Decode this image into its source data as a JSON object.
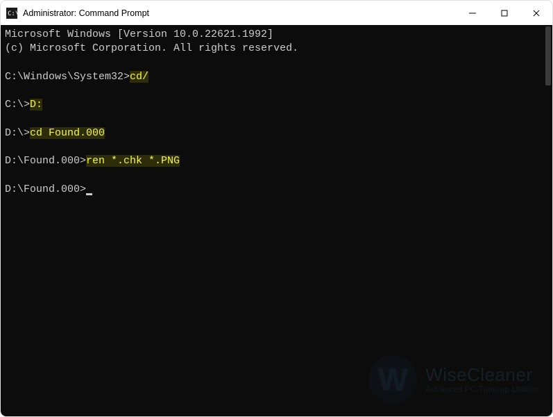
{
  "window": {
    "title": "Administrator: Command Prompt"
  },
  "terminal": {
    "version_line": "Microsoft Windows [Version 10.0.22621.1992]",
    "copyright_line": "(c) Microsoft Corporation. All rights reserved.",
    "entries": [
      {
        "prompt": "C:\\Windows\\System32>",
        "command": "cd/"
      },
      {
        "prompt": "C:\\>",
        "command": "D:"
      },
      {
        "prompt": "D:\\>",
        "command": "cd Found.000"
      },
      {
        "prompt": "D:\\Found.000>",
        "command": "ren *.chk *.PNG"
      }
    ],
    "current_prompt": "D:\\Found.000>"
  },
  "watermark": {
    "letter": "W",
    "brand": "WiseCleaner",
    "tagline": "Advanced PC Tune-up Utilities"
  }
}
